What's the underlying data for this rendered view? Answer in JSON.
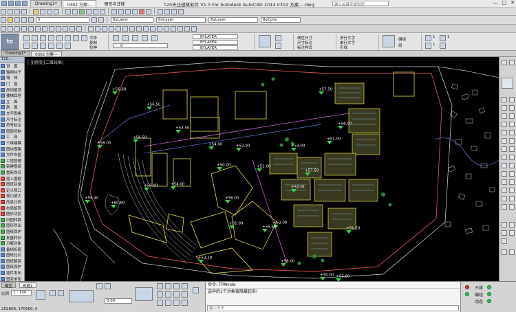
{
  "window": {
    "title": "T20天正建筑软件 V1.0 For Autodesk AutoCAD 2014    0302 方案---.dwg",
    "doc_tabs": [
      "Drawing1*",
      "0302 方案---"
    ],
    "menu_a": "图形与注释",
    "search_placeholder": "键入关键字或短语",
    "controls": [
      "—",
      "□",
      "✕"
    ]
  },
  "toolbar": {
    "layer_combo": "ByLayer",
    "linetype_combo": "ByLayer",
    "lineweight_combo": "ByLayer",
    "plot_combo": "ByColor"
  },
  "ribbon": {
    "logo_text": "tc",
    "tools_left": [
      "平移",
      "复制",
      "拉伸"
    ],
    "layer_labels": [
      "BYLAYER",
      "BYLAYER",
      "BYLAYER"
    ],
    "layer_current": "0",
    "dim_labels": [
      "线性尺寸",
      "尺寸标注",
      "标注样式"
    ],
    "annot_labels": [
      "多行文字",
      "单行文字",
      "引线"
    ],
    "group_labels": [
      "编组",
      "组"
    ],
    "counts": [
      "1",
      "1",
      "1"
    ]
  },
  "filetabs": [
    "Drawing1*",
    "0302 方案---"
  ],
  "view_label": "[-][俯视][二维线框]",
  "palette": {
    "header": "T20...",
    "items": [
      {
        "label": "设　置",
        "kind": "blue"
      },
      {
        "label": "轴网柱子",
        "kind": "blue"
      },
      {
        "label": "墙　体",
        "kind": "blue"
      },
      {
        "label": "门　窗",
        "kind": "blue"
      },
      {
        "label": "房间屋顶",
        "kind": "blue"
      },
      {
        "label": "楼梯其他",
        "kind": "blue"
      },
      {
        "label": "立　面",
        "kind": "blue"
      },
      {
        "label": "剖　面",
        "kind": "blue"
      },
      {
        "label": "文字表格",
        "kind": "blue"
      },
      {
        "label": "尺寸标注",
        "kind": "blue"
      },
      {
        "label": "符号标注",
        "kind": "blue"
      },
      {
        "label": "图层控制",
        "kind": "blue"
      },
      {
        "label": "工　具",
        "kind": "blue"
      },
      {
        "label": "三维建模",
        "kind": "blue"
      },
      {
        "label": "图块图案",
        "kind": "blue"
      },
      {
        "label": "文件布图",
        "kind": "blue"
      },
      {
        "label": "工程管理",
        "kind": "grn"
      },
      {
        "label": "新建图纸",
        "kind": "grn"
      },
      {
        "label": "重新命名",
        "kind": "grn"
      },
      {
        "label": "插入图框",
        "kind": "red"
      },
      {
        "label": "图纸目录",
        "kind": "red"
      },
      {
        "label": "定义视口",
        "kind": "red"
      },
      {
        "label": "视口放大",
        "kind": "red"
      },
      {
        "label": "改变比例",
        "kind": "red"
      },
      {
        "label": "布局旋转",
        "kind": "red"
      },
      {
        "label": "图形切割",
        "kind": "red"
      },
      {
        "label": "旧图转换",
        "kind": "grn"
      },
      {
        "label": "图形导出",
        "kind": "grn"
      },
      {
        "label": "图纸保护",
        "kind": "grn"
      },
      {
        "label": "批量转旧",
        "kind": "grn"
      },
      {
        "label": "分解对象",
        "kind": "grn"
      },
      {
        "label": "备档拆图",
        "kind": "blue"
      },
      {
        "label": "图纸比对",
        "kind": "blue"
      },
      {
        "label": "图纸解锁",
        "kind": "blue"
      },
      {
        "label": "图纸保护",
        "kind": "blue"
      },
      {
        "label": "插件发布",
        "kind": "blue"
      },
      {
        "label": "图变单色",
        "kind": "blue"
      }
    ]
  },
  "elevations": [
    "+56.60",
    "+56.50",
    "+53.50",
    "+58.00",
    "+56.50",
    "+54.00",
    "+52.00",
    "+58.40",
    "+60.60",
    "+56.90",
    "+54.00",
    "+50.00",
    "+52.10",
    "+52.00",
    "+56.00",
    "+61.00",
    "+55.50",
    "+57.50",
    "+51.00",
    "+53.00",
    "+57.50",
    "+52.01",
    "+52.00",
    "+58.00",
    "+56.00",
    "+51.20",
    "+50.00",
    "+53.00"
  ],
  "bottom": {
    "tabs": [
      "模型",
      "布局1"
    ],
    "scale_label": "比例",
    "scale_value": "1 : 100",
    "elev_value": "0.00",
    "coords": "252808, 170560, 0",
    "cmd_history": [
      "命令: TPAHide",
      "选中的1个对象被隐藏起来!"
    ],
    "cmd_prompt": "键入命令",
    "status": [
      "三维",
      "编组",
      "动态"
    ]
  }
}
